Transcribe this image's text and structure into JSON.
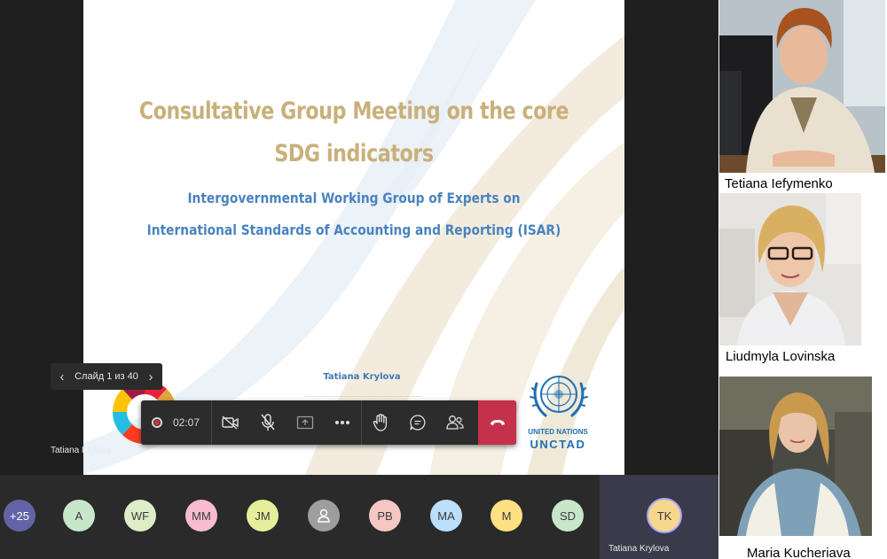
{
  "slide": {
    "title_line1": "Consultative Group Meeting on the core",
    "title_line2": "SDG indicators",
    "subtitle_line1": "Intergovernmental Working Group of Experts on",
    "subtitle_line2": "International Standards of Accounting and Reporting (ISAR)",
    "presenter": "Tatiana Krylova",
    "logo_text_line1": "UNITED NATIONS",
    "logo_text_line2": "UNCTAD",
    "colors": {
      "title": "#c9b07a",
      "subtitle": "#4a83bf",
      "un_blue": "#1e6fb5"
    }
  },
  "slide_nav": {
    "counter": "Слайд 1 из 40",
    "prev_icon": "chevron-left-icon",
    "next_icon": "chevron-right-icon"
  },
  "speaker_label": "Tatiana Krylova",
  "toolbar": {
    "record_time": "02:07",
    "buttons": [
      "camera-off-icon",
      "mic-off-icon",
      "share-screen-icon",
      "more-icon",
      "raise-hand-icon",
      "chat-icon",
      "participants-icon",
      "hang-up-icon"
    ],
    "hangup_color": "#c4314b"
  },
  "participants": [
    {
      "initials": "+25",
      "color": "#6264a7"
    },
    {
      "initials": "A",
      "color": "#c8e6c9"
    },
    {
      "initials": "WF",
      "color": "#dcedc8"
    },
    {
      "initials": "MM",
      "color": "#f8bbd0"
    },
    {
      "initials": "JM",
      "color": "#e6ee9c"
    },
    {
      "initials": "",
      "color": "#9e9e9e"
    },
    {
      "initials": "PB",
      "color": "#f4c7c3"
    },
    {
      "initials": "MA",
      "color": "#bbdefb"
    },
    {
      "initials": "M",
      "color": "#ffe082"
    },
    {
      "initials": "SD",
      "color": "#c8e6c9"
    }
  ],
  "self_tile": {
    "initials": "TK",
    "name": "Tatiana Krylova",
    "color": "#f5d78e"
  },
  "video_tiles": [
    {
      "name": "Tetiana Iefymenko"
    },
    {
      "name": "Liudmyla Lovinska"
    },
    {
      "name": "Maria Kucheriava"
    }
  ]
}
